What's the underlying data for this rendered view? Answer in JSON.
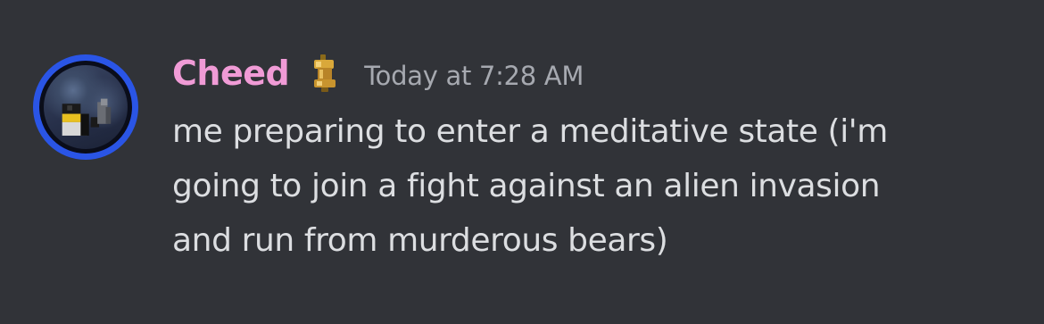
{
  "message": {
    "author": "Cheed",
    "timestamp": "Today at 7:28 AM",
    "role_icon": "gold-bar-icon",
    "content_lines": [
      "me preparing to enter a meditative state (i'm",
      "going to join a fight against an alien invasion",
      "and run from murderous bears)"
    ]
  },
  "colors": {
    "background": "#313338",
    "username": "#f09bd6",
    "timestamp": "#a6a9b0",
    "text": "#dcdee1",
    "avatar_ring": "#2a55e6"
  }
}
